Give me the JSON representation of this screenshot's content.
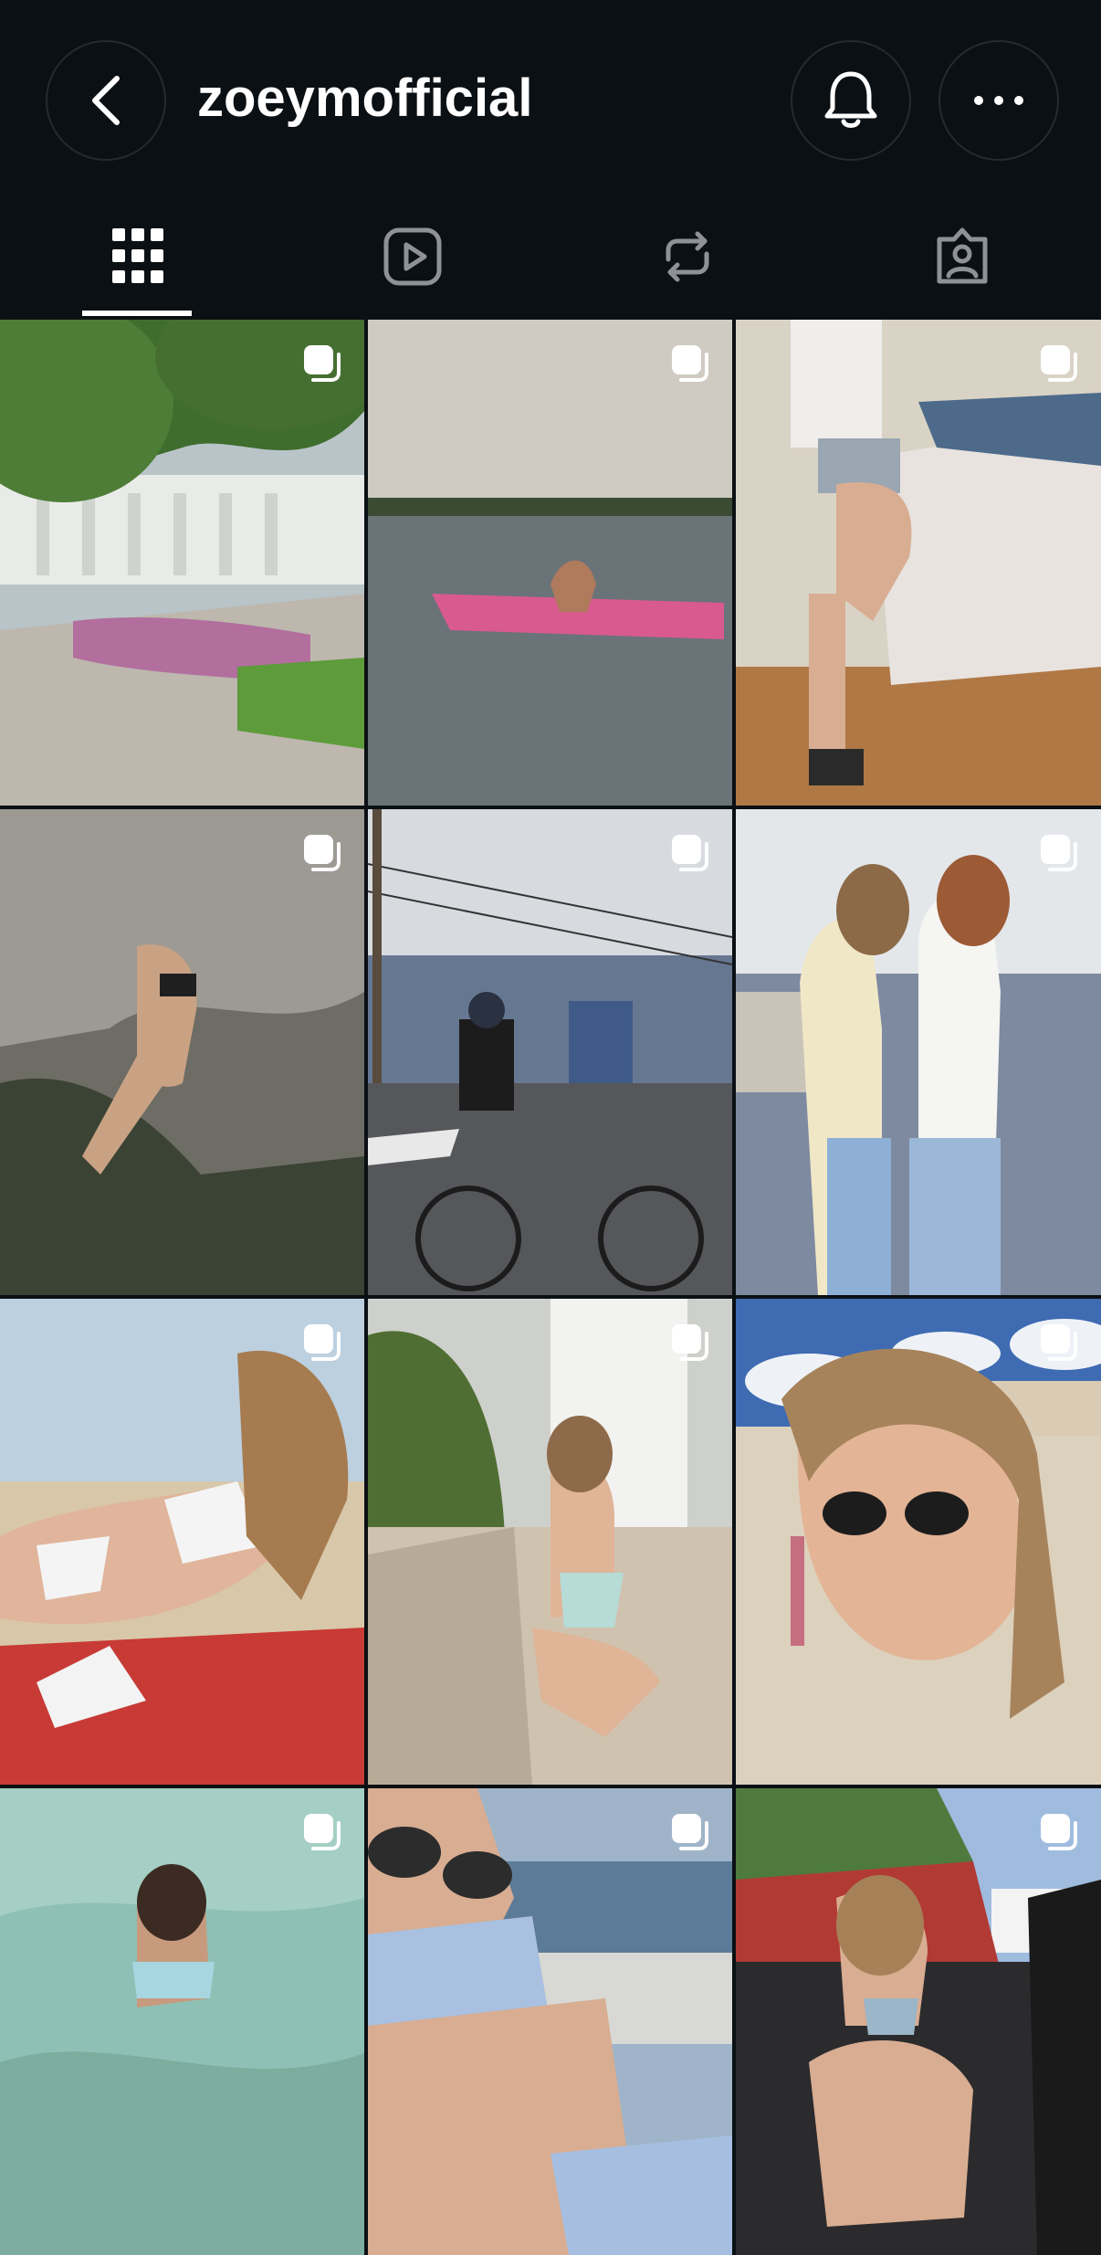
{
  "header": {
    "username": "zoeymofficial",
    "back_icon": "chevron-left-icon",
    "notification_icon": "bell-icon",
    "more_icon": "more-horizontal-icon"
  },
  "tabs": [
    {
      "name": "grid",
      "icon": "grid-icon",
      "selected": true
    },
    {
      "name": "reels",
      "icon": "reels-icon",
      "selected": false
    },
    {
      "name": "reposts",
      "icon": "repost-icon",
      "selected": false
    },
    {
      "name": "tagged",
      "icon": "tagged-icon",
      "selected": false
    }
  ],
  "colors": {
    "background": "#0b1014",
    "text": "#ffffff",
    "button_border": "#262a2f"
  },
  "posts": [
    {
      "id": 1,
      "type": "carousel"
    },
    {
      "id": 2,
      "type": "carousel"
    },
    {
      "id": 3,
      "type": "carousel"
    },
    {
      "id": 4,
      "type": "carousel"
    },
    {
      "id": 5,
      "type": "carousel"
    },
    {
      "id": 6,
      "type": "carousel"
    },
    {
      "id": 7,
      "type": "carousel"
    },
    {
      "id": 8,
      "type": "carousel"
    },
    {
      "id": 9,
      "type": "carousel"
    },
    {
      "id": 10,
      "type": "carousel"
    },
    {
      "id": 11,
      "type": "carousel"
    },
    {
      "id": 12,
      "type": "carousel"
    }
  ]
}
